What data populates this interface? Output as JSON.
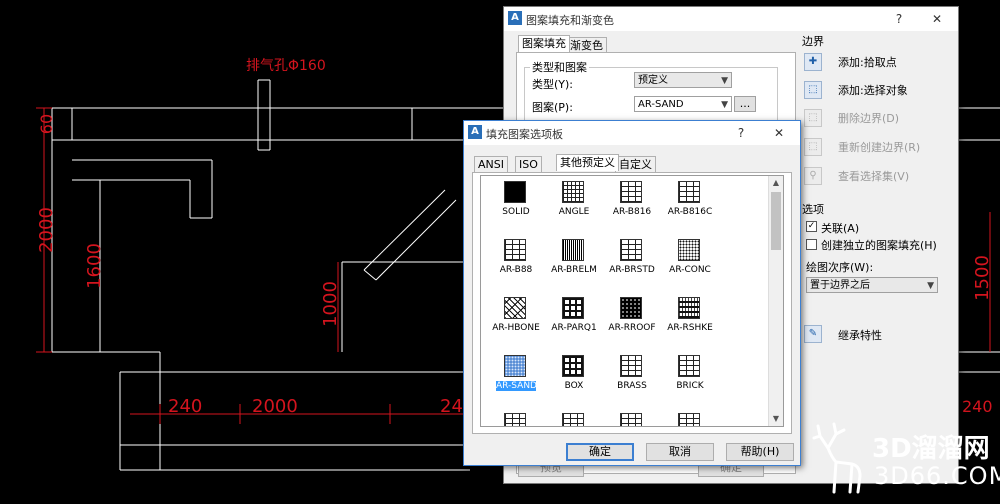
{
  "cad": {
    "annotation_label": "排气孔Φ160",
    "dimensions": [
      "60",
      "2000",
      "1600",
      "1000",
      "240",
      "2000",
      "24",
      "1500",
      "240"
    ]
  },
  "hatch_dialog": {
    "title": "图案填充和渐变色",
    "help_symbol": "?",
    "close_symbol": "✕",
    "tabs": [
      "图案填充",
      "渐变色"
    ],
    "type_pattern_group": "类型和图案",
    "type_label": "类型(Y):",
    "type_value": "预定义",
    "pattern_label": "图案(P):",
    "pattern_value": "AR-SAND",
    "browse_label": "...",
    "boundaries_title": "边界",
    "boundary_items": [
      {
        "label": "添加:拾取点",
        "icon": "pick-point-icon",
        "enabled": true
      },
      {
        "label": "添加:选择对象",
        "icon": "select-objects-icon",
        "enabled": true
      },
      {
        "label": "删除边界(D)",
        "icon": "remove-boundary-icon",
        "enabled": false
      },
      {
        "label": "重新创建边界(R)",
        "icon": "recreate-boundary-icon",
        "enabled": false
      },
      {
        "label": "查看选择集(V)",
        "icon": "view-selection-icon",
        "enabled": false
      }
    ],
    "options_title": "选项",
    "associative_label": "关联(A)",
    "associative_checked": true,
    "separate_label": "创建独立的图案填充(H)",
    "separate_checked": false,
    "draw_order_label": "绘图次序(W):",
    "draw_order_value": "置于边界之后",
    "inherit_label": "继承特性",
    "bottom_buttons": [
      "预览",
      "确定"
    ]
  },
  "palette_dialog": {
    "title": "填充图案选项板",
    "help_symbol": "?",
    "close_symbol": "✕",
    "tabs": [
      "ANSI",
      "ISO",
      "其他预定义",
      "自定义"
    ],
    "active_tab": "其他预定义",
    "patterns": [
      {
        "name": "SOLID",
        "style": "solid"
      },
      {
        "name": "ANGLE",
        "style": "grid"
      },
      {
        "name": "AR-B816",
        "style": "brick"
      },
      {
        "name": "AR-B816C",
        "style": "brick"
      },
      {
        "name": "AR-B88",
        "style": "brick"
      },
      {
        "name": "AR-BRELM",
        "style": "dense"
      },
      {
        "name": "AR-BRSTD",
        "style": "brick"
      },
      {
        "name": "AR-CONC",
        "style": "dots"
      },
      {
        "name": "AR-HBONE",
        "style": "herring"
      },
      {
        "name": "AR-PARQ1",
        "style": "box"
      },
      {
        "name": "AR-RROOF",
        "style": "roof"
      },
      {
        "name": "AR-RSHKE",
        "style": "shake"
      },
      {
        "name": "AR-SAND",
        "style": "sand",
        "selected": true
      },
      {
        "name": "BOX",
        "style": "box"
      },
      {
        "name": "BRASS",
        "style": "brick"
      },
      {
        "name": "BRICK",
        "style": "brick"
      }
    ],
    "buttons": {
      "ok": "确定",
      "cancel": "取消",
      "help": "帮助(H)"
    }
  },
  "watermark": {
    "brand": "3D溜溜网",
    "url": "3D66.COM"
  },
  "colors": {
    "cad_lines": "#ffffff",
    "dimension_red": "#d4141e",
    "selection": "#3399ff",
    "dialog_bg": "#f0f0f0"
  }
}
